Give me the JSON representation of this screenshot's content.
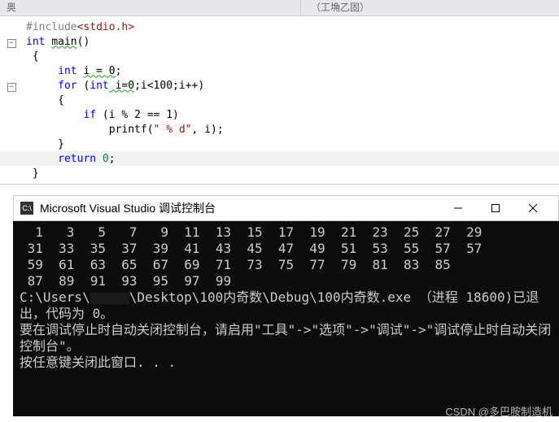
{
  "tabs": {
    "left": "奥",
    "right": "（工埆乙固）"
  },
  "code": {
    "l1_inc": "#include",
    "l1_hdr": "<stdio.h>",
    "l2_int": "int",
    "l2_main": "main",
    "l2_paren": "()",
    "l3": "{",
    "l4_int": "int",
    "l4_var": "i = 0",
    "l4_semi": ";",
    "l5_for": "for",
    "l5_open": " (",
    "l5_int": "int",
    "l5_cond": " i=0",
    "l5_rest": ";i<100;i++)",
    "l6": "{",
    "l7_if": "if",
    "l7_cond": " (i % 2 == 1)",
    "l8_fn": "printf",
    "l8_open": "(",
    "l8_str": "\" % d\"",
    "l8_rest": ", i);",
    "l9": "}",
    "l10_ret": "return",
    "l10_val": " 0",
    "l10_semi": ";",
    "l11": "}"
  },
  "console": {
    "title": "Microsoft Visual Studio 调试控制台",
    "row1": "  1   3   5   7   9  11  13  15  17  19  21  23  25  27  29",
    "row2": " 31  33  35  37  39  41  43  45  47  49  51  53  55  57  57",
    "row3": " 59  61  63  65  67  69  71  73  75  77  79  81  83  85",
    "row4": " 87  89  91  93  95  97  99",
    "path_pre": "C:\\Users\\",
    "path_post": "\\Desktop\\100内奇数\\Debug\\100内奇数.exe （进程 18600)已退出，代码为 0。",
    "msg2": "要在调试停止时自动关闭控制台，请启用\"工具\"->\"选项\"->\"调试\"->\"调试停止时自动关闭控制台\"。",
    "msg3": "按任意键关闭此窗口. . ."
  },
  "watermark": "CSDN @多巴胺制造机",
  "chart_data": {
    "type": "table",
    "title": "Odd numbers 1–99 printed by program",
    "values": [
      1,
      3,
      5,
      7,
      9,
      11,
      13,
      15,
      17,
      19,
      21,
      23,
      25,
      27,
      29,
      31,
      33,
      35,
      37,
      39,
      41,
      43,
      45,
      47,
      49,
      51,
      53,
      55,
      57,
      59,
      61,
      63,
      65,
      67,
      69,
      71,
      73,
      75,
      77,
      79,
      81,
      83,
      85,
      87,
      89,
      91,
      93,
      95,
      97,
      99
    ]
  }
}
